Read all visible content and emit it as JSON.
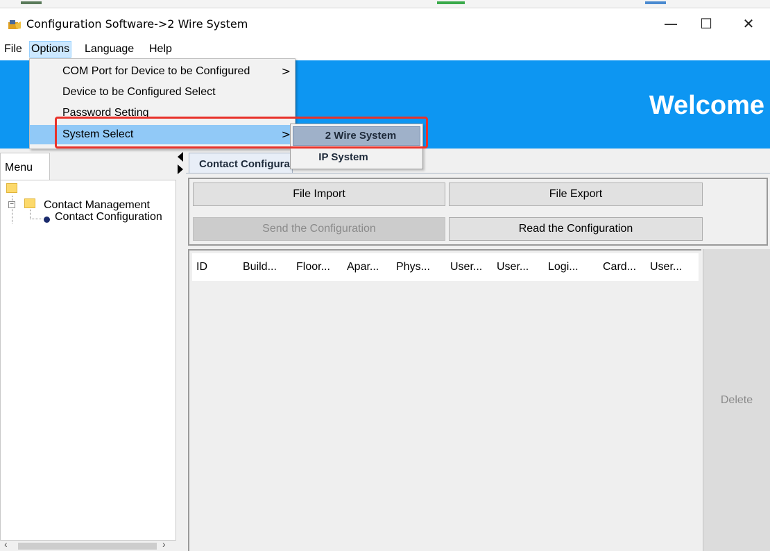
{
  "window": {
    "title": "Configuration Software->2 Wire System",
    "minimize_glyph": "—",
    "maximize_glyph": "☐",
    "close_glyph": "✕"
  },
  "menubar": {
    "file": "File",
    "options": "Options",
    "language": "Language",
    "help": "Help"
  },
  "banner": {
    "welcome": "Welcome",
    "color": "#0d96f2"
  },
  "options_menu": {
    "items": [
      {
        "label": "COM Port for Device to be Configured",
        "has_submenu": true
      },
      {
        "label": "Device to be Configured Select",
        "has_submenu": false
      },
      {
        "label": "Password Setting",
        "has_submenu": false
      },
      {
        "label": "System Select",
        "has_submenu": true
      }
    ],
    "submenu_arrow": ">"
  },
  "system_submenu": {
    "items": [
      {
        "label": "2 Wire System",
        "selected": true
      },
      {
        "label": "IP System",
        "selected": false
      }
    ]
  },
  "left_panel": {
    "tab": "Menu",
    "tree": {
      "expander": "−",
      "group": "Contact Management",
      "child": "Contact Configuration"
    },
    "scroll_left": "‹",
    "scroll_right": "›"
  },
  "right_panel": {
    "tab": "Contact Configuration",
    "buttons": {
      "file_import": "File Import",
      "file_export": "File Export",
      "send_config": "Send the Configuration",
      "read_config": "Read the Configuration",
      "delete": "Delete"
    },
    "columns": [
      "ID",
      "Build...",
      "Floor...",
      "Apar...",
      "Phys...",
      "User...",
      "User...",
      "Logi...",
      "Card...",
      "User..."
    ]
  },
  "highlight_color": "#e8322a"
}
